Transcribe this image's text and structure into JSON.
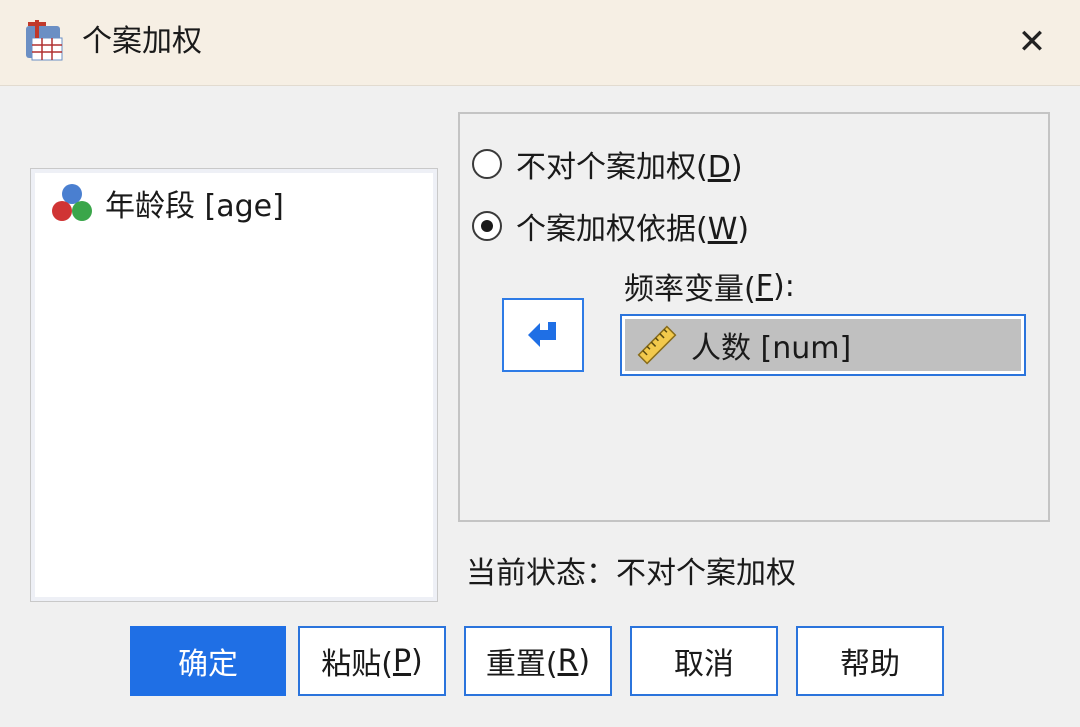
{
  "window": {
    "title": "个案加权",
    "close_glyph": "✕"
  },
  "variables": [
    {
      "label": "年龄段 [age]",
      "icon": "nominal-variable-icon"
    }
  ],
  "options": {
    "no_weight": {
      "text": "不对个案加权(",
      "mnemonic": "D",
      "close": ")",
      "selected": false
    },
    "weight_by": {
      "text": "个案加权依据(",
      "mnemonic": "W",
      "close": ")",
      "selected": true
    },
    "freq_label": {
      "text": "频率变量(",
      "mnemonic": "F",
      "close": "):"
    },
    "freq_variable": {
      "label": "人数 [num]",
      "icon": "scale-ruler-icon"
    }
  },
  "status": {
    "prefix": "当前状态：",
    "value": "不对个案加权"
  },
  "buttons": {
    "ok": "确定",
    "paste": {
      "text": "粘贴(",
      "mnemonic": "P",
      "close": ")"
    },
    "reset": {
      "text": "重置(",
      "mnemonic": "R",
      "close": ")"
    },
    "cancel": "取消",
    "help": "帮助"
  },
  "colors": {
    "accent": "#1f6fe5",
    "titlebar": "#f6efe4",
    "selection": "#c0c0c0"
  }
}
